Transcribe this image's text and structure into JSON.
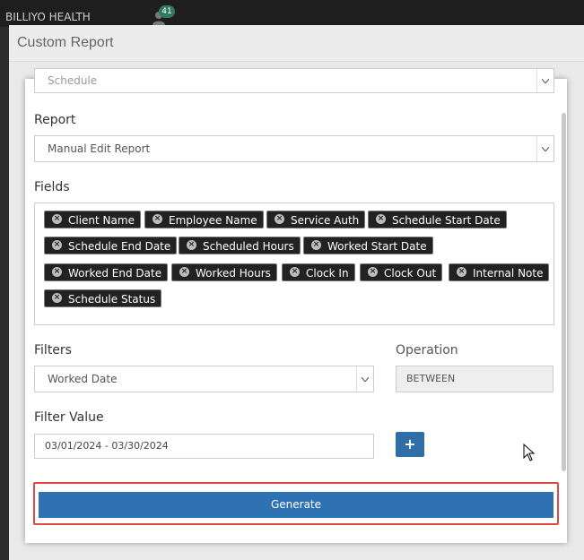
{
  "app": {
    "brand": "BILLIYO HEALTH",
    "notification_count": "41"
  },
  "modal": {
    "title": "Custom Report"
  },
  "form": {
    "category_value": "Schedule",
    "report": {
      "label": "Report",
      "value": "Manual Edit Report"
    },
    "fields": {
      "label": "Fields",
      "chips": [
        "Client Name",
        "Employee Name",
        "Service Auth",
        "Schedule Start Date",
        "Schedule End Date",
        "Scheduled Hours",
        "Worked Start Date",
        "Worked End Date",
        "Worked Hours",
        "Clock In",
        "Clock Out",
        "Internal Note",
        "Schedule Status"
      ]
    },
    "filters": {
      "label": "Filters",
      "value": "Worked Date"
    },
    "operation": {
      "label": "Operation",
      "value": "BETWEEN"
    },
    "filter_value": {
      "label": "Filter Value",
      "value": "03/01/2024 - 03/30/2024"
    },
    "add_button": "+",
    "generate_button": "Generate"
  },
  "colors": {
    "primary": "#2f72b3",
    "highlight": "#e04848",
    "chip_bg": "#222222"
  }
}
